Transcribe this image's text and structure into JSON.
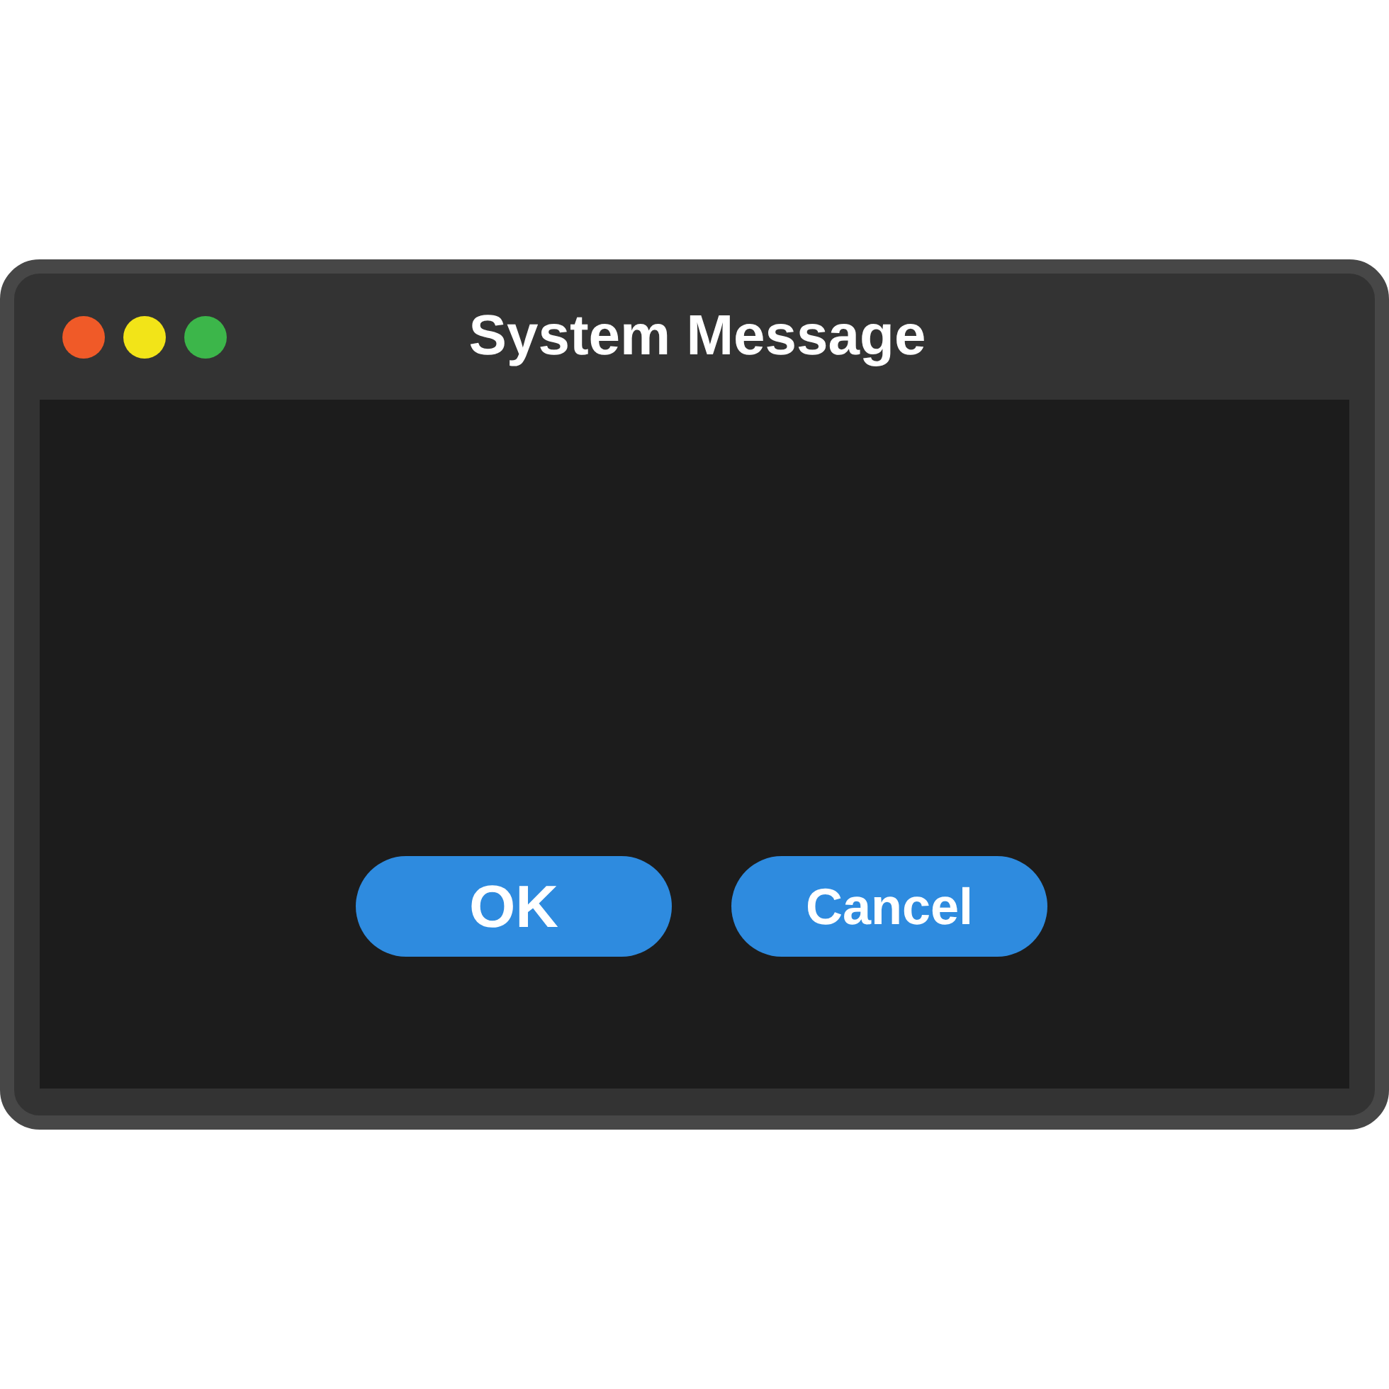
{
  "window": {
    "title": "System Message",
    "controls": [
      {
        "color": "#f05a28"
      },
      {
        "color": "#f2e418"
      },
      {
        "color": "#3cb64a"
      }
    ]
  },
  "buttons": [
    "OK",
    "Cancel"
  ]
}
